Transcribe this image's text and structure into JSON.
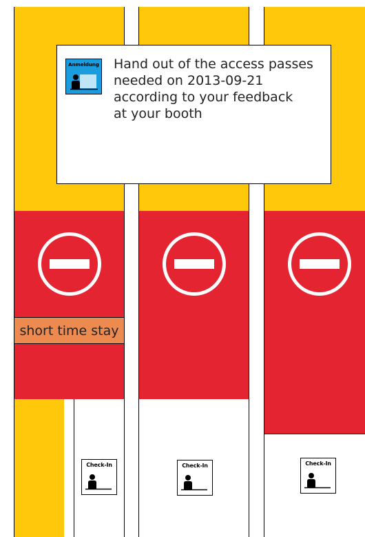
{
  "notice": {
    "icon_label": "Anmeldung",
    "lines": [
      "Hand out of the access passes",
      "needed on 2013-09-21",
      "according to your feedback",
      "at your booth"
    ]
  },
  "columns": [
    {
      "label": "short time stay",
      "checkin_label": "Check-In"
    },
    {
      "checkin_label": "Check-In"
    },
    {
      "checkin_label": "Check-In"
    }
  ],
  "icons": {
    "no_entry": "no-entry-sign-icon",
    "person": "person-at-desk-icon"
  },
  "colors": {
    "yellow": "#ffc80a",
    "red": "#e52431",
    "orange": "#ed8a4f",
    "blue": "#1a9ddf"
  }
}
